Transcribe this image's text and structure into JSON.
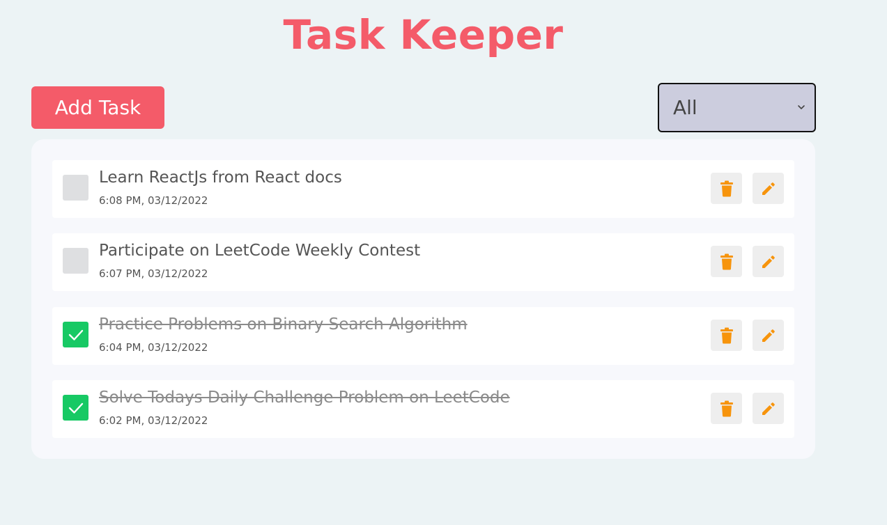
{
  "app": {
    "title": "Task Keeper"
  },
  "toolbar": {
    "add_label": "Add Task",
    "filter_selected": "All"
  },
  "colors": {
    "accent": "#f45b69",
    "checked": "#17c964",
    "action_icon": "#f7940c",
    "background": "#ecf3f5"
  },
  "tasks": [
    {
      "title": "Learn ReactJs from React docs",
      "time": "6:08 PM, 03/12/2022",
      "completed": false
    },
    {
      "title": "Participate on LeetCode Weekly Contest",
      "time": "6:07 PM, 03/12/2022",
      "completed": false
    },
    {
      "title": "Practice Problems on Binary Search Algorithm",
      "time": "6:04 PM, 03/12/2022",
      "completed": true
    },
    {
      "title": "Solve Todays Daily Challenge Problem on LeetCode",
      "time": "6:02 PM, 03/12/2022",
      "completed": true
    }
  ],
  "icons": {
    "delete": "trash-icon",
    "edit": "pencil-icon",
    "check": "check-icon",
    "dropdown": "chevron-down-icon"
  }
}
